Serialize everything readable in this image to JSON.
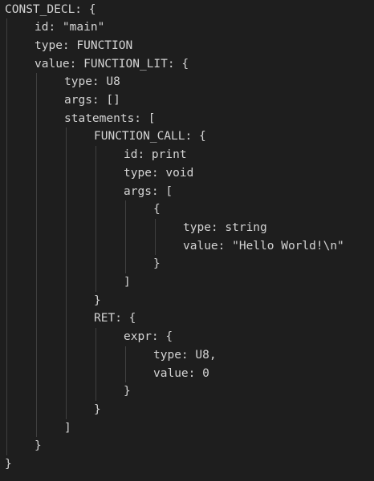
{
  "editor": {
    "background_color": "#1e1e1e",
    "text_color": "#d4d4d4",
    "guide_color": "#404040",
    "lines": [
      {
        "indent": 0,
        "text": "CONST_DECL: {"
      },
      {
        "indent": 1,
        "text": "id: \"main\""
      },
      {
        "indent": 1,
        "text": "type: FUNCTION"
      },
      {
        "indent": 1,
        "text": "value: FUNCTION_LIT: {"
      },
      {
        "indent": 2,
        "text": "type: U8"
      },
      {
        "indent": 2,
        "text": "args: []"
      },
      {
        "indent": 2,
        "text": "statements: ["
      },
      {
        "indent": 3,
        "text": "FUNCTION_CALL: {"
      },
      {
        "indent": 4,
        "text": "id: print"
      },
      {
        "indent": 4,
        "text": "type: void"
      },
      {
        "indent": 4,
        "text": "args: ["
      },
      {
        "indent": 5,
        "text": "{"
      },
      {
        "indent": 6,
        "text": "type: string"
      },
      {
        "indent": 6,
        "text": "value: \"Hello World!\\n\""
      },
      {
        "indent": 5,
        "text": "}"
      },
      {
        "indent": 4,
        "text": "]"
      },
      {
        "indent": 3,
        "text": "}"
      },
      {
        "indent": 3,
        "text": "RET: {"
      },
      {
        "indent": 4,
        "text": "expr: {"
      },
      {
        "indent": 5,
        "text": "type: U8,"
      },
      {
        "indent": 5,
        "text": "value: 0"
      },
      {
        "indent": 4,
        "text": "}"
      },
      {
        "indent": 3,
        "text": "}"
      },
      {
        "indent": 2,
        "text": "]"
      },
      {
        "indent": 1,
        "text": "}"
      },
      {
        "indent": 0,
        "text": "}"
      }
    ]
  }
}
